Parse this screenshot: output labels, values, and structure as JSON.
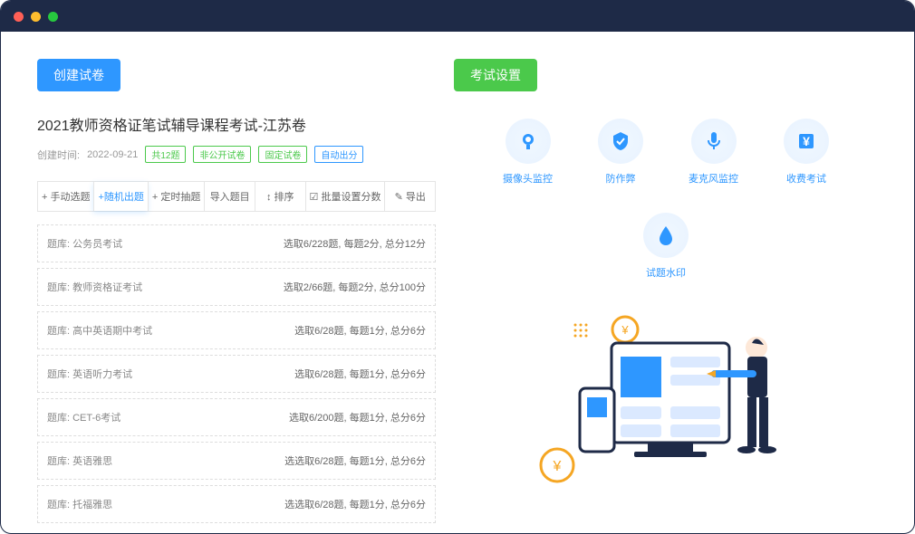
{
  "left": {
    "button": "创建试卷",
    "title": "2021教师资格证笔试辅导课程考试-江苏卷",
    "create_time_label": "创建时间:",
    "create_time": "2022-09-21",
    "tags": [
      "共12题",
      "非公开试卷",
      "固定试卷",
      "自动出分"
    ],
    "tabs": [
      "+ 手动选题",
      "+随机出题",
      "+ 定时抽题",
      "导入题目",
      "↕ 排序",
      "☑ 批量设置分数",
      "✎ 导出"
    ],
    "rows": [
      {
        "bank": "题库: 公务员考试",
        "stat": "选取6/228题, 每题2分, 总分12分"
      },
      {
        "bank": "题库: 教师资格证考试",
        "stat": "选取2/66题, 每题2分, 总分100分"
      },
      {
        "bank": "题库: 高中英语期中考试",
        "stat": "选取6/28题, 每题1分, 总分6分"
      },
      {
        "bank": "题库: 英语听力考试",
        "stat": "选取6/28题, 每题1分, 总分6分"
      },
      {
        "bank": "题库: CET-6考试",
        "stat": "选取6/200题, 每题1分, 总分6分"
      },
      {
        "bank": "题库: 英语雅思",
        "stat": "选选取6/28题, 每题1分, 总分6分"
      },
      {
        "bank": "题库: 托福雅思",
        "stat": "选选取6/28题, 每题1分, 总分6分"
      }
    ]
  },
  "right": {
    "button": "考试设置",
    "features": [
      {
        "icon": "camera",
        "label": "摄像头监控"
      },
      {
        "icon": "shield",
        "label": "防作弊"
      },
      {
        "icon": "mic",
        "label": "麦克风监控"
      },
      {
        "icon": "pay",
        "label": "收费考试"
      },
      {
        "icon": "drop",
        "label": "试题水印"
      }
    ]
  }
}
